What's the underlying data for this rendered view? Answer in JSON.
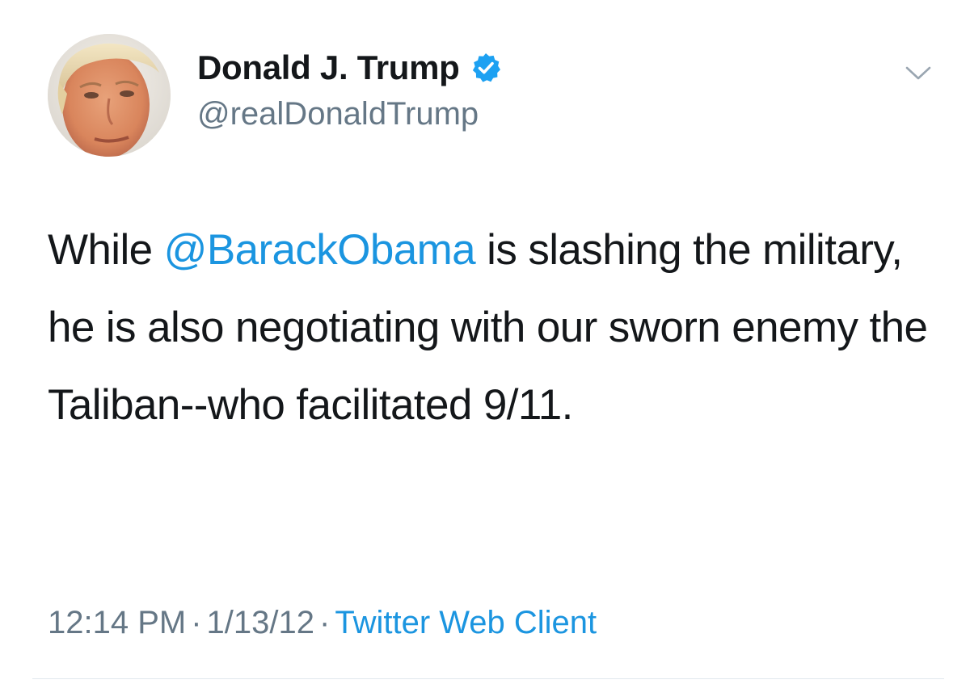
{
  "author": {
    "display_name": "Donald J. Trump",
    "handle": "@realDonaldTrump",
    "verified": true,
    "avatar_icon": "profile-photo"
  },
  "tweet": {
    "text_before_mention": "While ",
    "mention": "@BarackObama",
    "text_after_mention": " is slashing the military, he is also negotiating with our sworn enemy the Taliban--who facilitated 9/11."
  },
  "meta": {
    "time": "12:14 PM",
    "separator": "·",
    "date": "1/13/12",
    "source": "Twitter Web Client"
  },
  "icons": {
    "verified": "verified-badge-icon",
    "menu": "chevron-down-icon"
  },
  "colors": {
    "link": "#1b95e0",
    "verified": "#1da1f2",
    "secondary_text": "#657786",
    "primary_text": "#14171a",
    "divider": "#e1e8ed"
  }
}
